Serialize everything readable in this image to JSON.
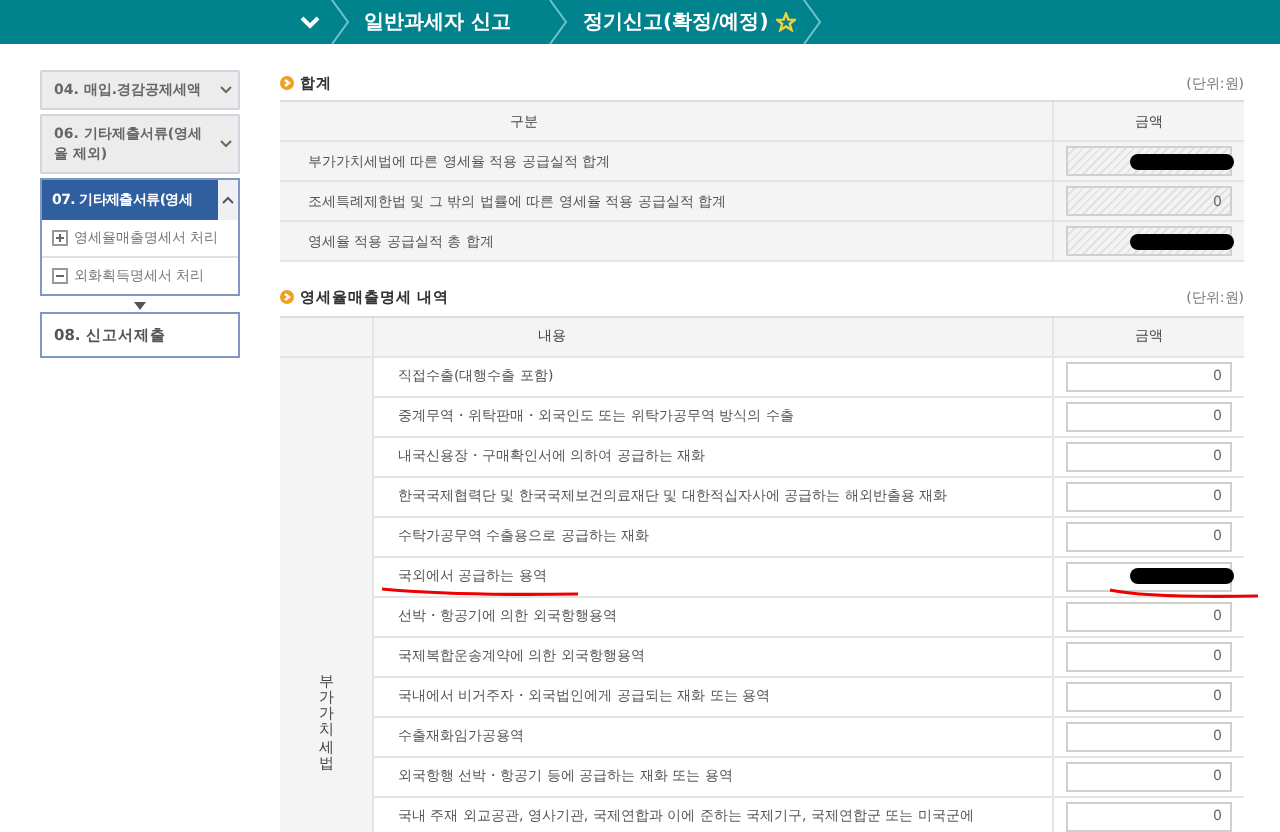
{
  "breadcrumb": {
    "items": [
      "일반과세자 신고",
      "정기신고(확정/예정)"
    ]
  },
  "sidebar": {
    "items": [
      {
        "label": "04. 매입.경감공제세액",
        "kind": "collapsed",
        "selected": false
      },
      {
        "label": "06. 기타제출서류(영세율 제외)",
        "kind": "collapsed",
        "selected": false
      },
      {
        "label": "07. 기타제출서류(영세",
        "kind": "expanded",
        "selected": true,
        "children": [
          {
            "label": "영세율매출명세서 처리",
            "expanded": false
          },
          {
            "label": "외화획득명세서 처리",
            "expanded": true
          }
        ]
      },
      {
        "label": "08. 신고서제출",
        "kind": "final",
        "selected": false
      }
    ]
  },
  "summary": {
    "title": "합계",
    "unit": "(단위:원)",
    "columns": [
      "구분",
      "금액"
    ],
    "rows": [
      {
        "label": "부가가치세법에 따른 영세율 적용 공급실적 합계",
        "value": "",
        "redacted": true
      },
      {
        "label": "조세특례제한법 및 그 밖의 법률에 따른 영세율 적용 공급실적 합계",
        "value": "0",
        "redacted": false
      },
      {
        "label": "영세율 적용 공급실적 총 합계",
        "value": "",
        "redacted": true
      }
    ]
  },
  "details": {
    "title": "영세율매출명세 내역",
    "unit": "(단위:원)",
    "columns": [
      "내용",
      "금액"
    ],
    "group": "부가가치세법",
    "rows": [
      {
        "label": "직접수출(대행수출 포함)",
        "value": "0",
        "redacted": false,
        "underlined": false
      },
      {
        "label": "중계무역・위탁판매・외국인도 또는 위탁가공무역 방식의 수출",
        "value": "0",
        "redacted": false,
        "underlined": false
      },
      {
        "label": "내국신용장・구매확인서에 의하여 공급하는 재화",
        "value": "0",
        "redacted": false,
        "underlined": false
      },
      {
        "label": "한국국제협력단 및 한국국제보건의료재단 및 대한적십자사에 공급하는 해외반출용 재화",
        "value": "0",
        "redacted": false,
        "underlined": false
      },
      {
        "label": "수탁가공무역 수출용으로 공급하는 재화",
        "value": "0",
        "redacted": false,
        "underlined": false
      },
      {
        "label": "국외에서 공급하는 용역",
        "value": "",
        "redacted": true,
        "underlined": true
      },
      {
        "label": "선박・항공기에 의한 외국항행용역",
        "value": "0",
        "redacted": false,
        "underlined": false
      },
      {
        "label": "국제복합운송계약에 의한 외국항행용역",
        "value": "0",
        "redacted": false,
        "underlined": false
      },
      {
        "label": "국내에서 비거주자・외국법인에게 공급되는 재화 또는 용역",
        "value": "0",
        "redacted": false,
        "underlined": false
      },
      {
        "label": "수출재화임가공용역",
        "value": "0",
        "redacted": false,
        "underlined": false
      },
      {
        "label": "외국항행 선박・항공기 등에 공급하는 재화 또는 용역",
        "value": "0",
        "redacted": false,
        "underlined": false
      },
      {
        "label": "국내 주재 외교공관, 영사기관, 국제연합과 이에 준하는 국제기구, 국제연합군 또는 미국군에",
        "value": "0",
        "redacted": false,
        "underlined": false
      }
    ]
  }
}
